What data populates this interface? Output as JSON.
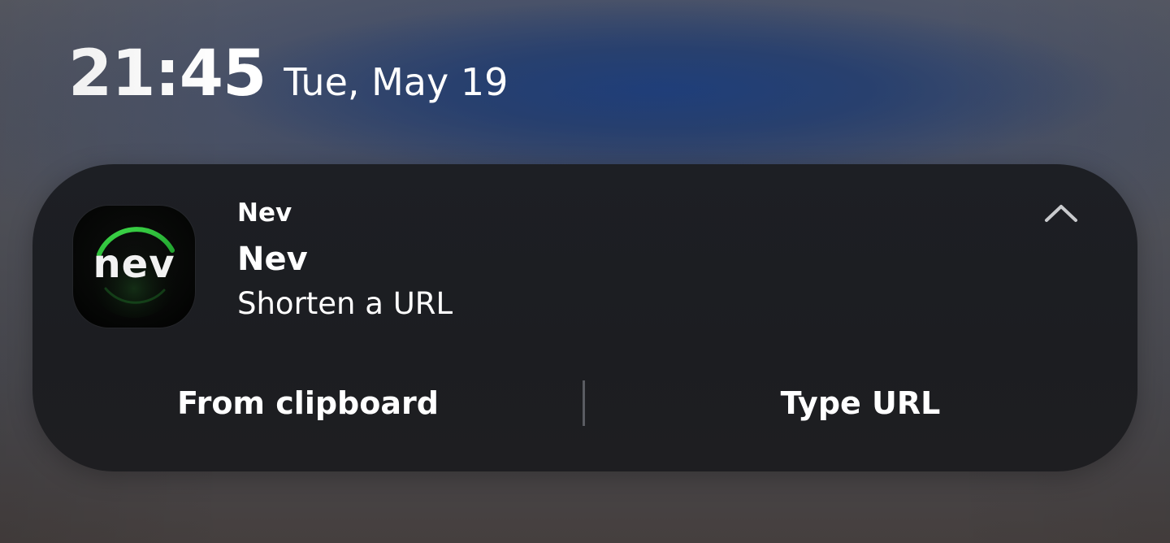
{
  "lockscreen": {
    "time": "21:45",
    "date": "Tue, May 19"
  },
  "notification": {
    "app_icon": {
      "name": "nev-app-icon",
      "text": "nev",
      "accent": "#2dc43a"
    },
    "app_name": "Nev",
    "title": "Nev",
    "body": "Shorten a URL",
    "collapse_icon": "chevron-up-icon",
    "actions": [
      {
        "label": "From clipboard"
      },
      {
        "label": "Type URL"
      }
    ]
  },
  "colors": {
    "card_background": "#1d1f24",
    "text": "#ffffff",
    "divider": "#5a5c62",
    "sky_accent": "#1e3e7a"
  }
}
